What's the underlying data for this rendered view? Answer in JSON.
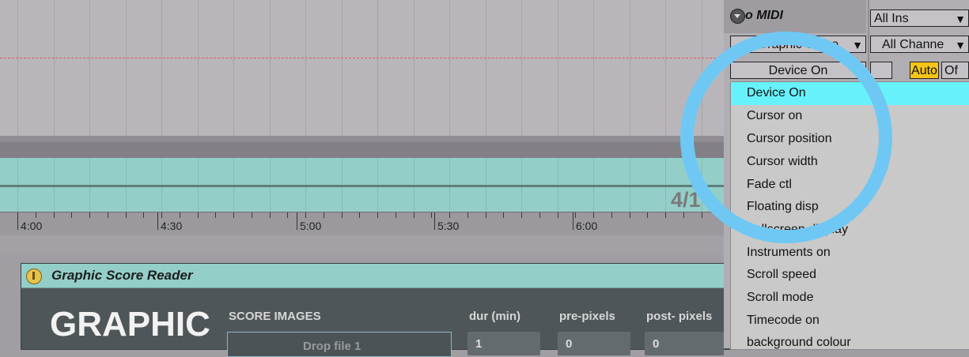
{
  "timeline": {
    "ratio": "4/1",
    "markers": [
      "4:00",
      "4:30",
      "5:00",
      "5:30",
      "6:00"
    ]
  },
  "device": {
    "title": "Graphic Score Reader",
    "big_title": "GRAPHIC",
    "score_images_label": "SCORE IMAGES",
    "drop_label": "Drop file 1",
    "columns": [
      "dur (min)",
      "pre-pixels",
      "post- pixels"
    ],
    "values": [
      "1",
      "0",
      "0"
    ]
  },
  "midi_panel": {
    "title": "o MIDI",
    "graphic_score_select": "Graphic Score",
    "device_select": "Device On",
    "input_select": "All Ins",
    "channel_select": "All Channe",
    "auto_label": "Auto",
    "off_label": "Of"
  },
  "dropdown": {
    "items": [
      "Device On",
      "Cursor on",
      "Cursor position",
      "Cursor width",
      "Fade ctl",
      "Floating disp",
      "Fullscreen display",
      "Instruments on",
      "Scroll speed",
      "Scroll mode",
      "Timecode on",
      "background colour"
    ],
    "selected_index": 0
  },
  "colors": {
    "accent_teal": "#93cfc8",
    "highlight": "#67f2fb",
    "overlay_circle": "#6fc8f4",
    "auto_button": "#f5c518"
  }
}
